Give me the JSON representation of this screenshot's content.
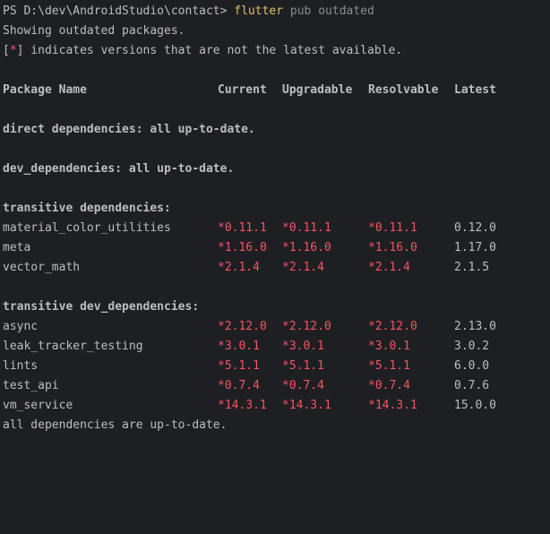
{
  "prompt": {
    "path": "PS D:\\dev\\AndroidStudio\\contact>",
    "command": "flutter",
    "args": "pub outdated"
  },
  "intro": {
    "line1": "Showing outdated packages.",
    "bracket_open": "[",
    "star": "*",
    "bracket_close": "]",
    "line2_rest": " indicates versions that are not the latest available."
  },
  "headers": {
    "name": "Package Name",
    "current": "Current",
    "upgradable": "Upgradable",
    "resolvable": "Resolvable",
    "latest": "Latest"
  },
  "sections": {
    "direct": "direct dependencies: all up-to-date.",
    "dev": "dev_dependencies: all up-to-date.",
    "transitive": "transitive dependencies:",
    "transitive_dev": "transitive dev_dependencies:"
  },
  "transitive_packages": [
    {
      "name": "material_color_utilities",
      "current": "*0.11.1",
      "upgradable": "*0.11.1",
      "resolvable": "*0.11.1",
      "latest": "0.12.0"
    },
    {
      "name": "meta",
      "current": "*1.16.0",
      "upgradable": "*1.16.0",
      "resolvable": "*1.16.0",
      "latest": "1.17.0"
    },
    {
      "name": "vector_math",
      "current": "*2.1.4",
      "upgradable": "*2.1.4",
      "resolvable": "*2.1.4",
      "latest": "2.1.5"
    }
  ],
  "transitive_dev_packages": [
    {
      "name": "async",
      "current": "*2.12.0",
      "upgradable": "*2.12.0",
      "resolvable": "*2.12.0",
      "latest": "2.13.0"
    },
    {
      "name": "leak_tracker_testing",
      "current": "*3.0.1",
      "upgradable": "*3.0.1",
      "resolvable": "*3.0.1",
      "latest": "3.0.2"
    },
    {
      "name": "lints",
      "current": "*5.1.1",
      "upgradable": "*5.1.1",
      "resolvable": "*5.1.1",
      "latest": "6.0.0"
    },
    {
      "name": "test_api",
      "current": "*0.7.4",
      "upgradable": "*0.7.4",
      "resolvable": "*0.7.4",
      "latest": "0.7.6"
    },
    {
      "name": "vm_service",
      "current": "*14.3.1",
      "upgradable": "*14.3.1",
      "resolvable": "*14.3.1",
      "latest": "15.0.0"
    }
  ],
  "footer": "all dependencies are up-to-date.",
  "colors": {
    "background": "#1e1f22",
    "text": "#bcbec4",
    "command": "#e0c068",
    "outdated": "#f75464"
  }
}
